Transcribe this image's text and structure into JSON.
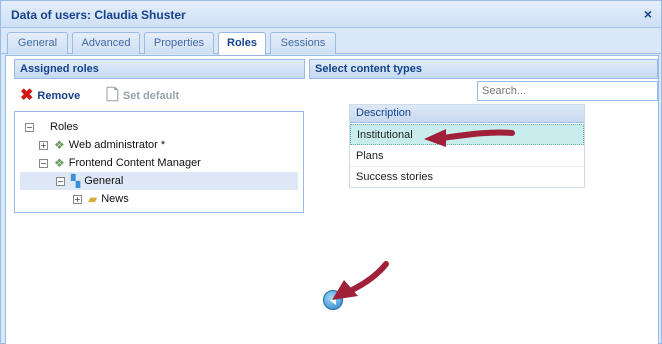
{
  "window": {
    "title": "Data of users: Claudia Shuster",
    "close_glyph": "×"
  },
  "tabs": [
    {
      "label": "General",
      "active": false
    },
    {
      "label": "Advanced",
      "active": false
    },
    {
      "label": "Properties",
      "active": false
    },
    {
      "label": "Roles",
      "active": true
    },
    {
      "label": "Sessions",
      "active": false
    }
  ],
  "assigned_roles": {
    "header": "Assigned roles",
    "toolbar": {
      "remove_label": "Remove",
      "remove_icon": "red-x-icon",
      "set_default_label": "Set default",
      "set_default_icon": "document-icon",
      "set_default_enabled": false
    },
    "tree": {
      "root": "Roles",
      "items": [
        {
          "label": "Web administrator *",
          "icon": "role-icon"
        },
        {
          "label": "Frontend Content Manager",
          "icon": "role-icon"
        },
        {
          "label": "General",
          "icon": "group-icon",
          "selected": true
        },
        {
          "label": "News",
          "icon": "folder-icon"
        }
      ]
    }
  },
  "content_types": {
    "header": "Select content types",
    "search_placeholder": "Search...",
    "column_header": "Description",
    "rows": [
      {
        "label": "Institutional",
        "selected": true
      },
      {
        "label": "Plans",
        "selected": false
      },
      {
        "label": "Success stories",
        "selected": false
      }
    ]
  },
  "colors": {
    "accent": "#15428b",
    "panel_border": "#99bbe8",
    "annotation_arrow": "#a0203a",
    "selected_row": "#c9ecec"
  }
}
